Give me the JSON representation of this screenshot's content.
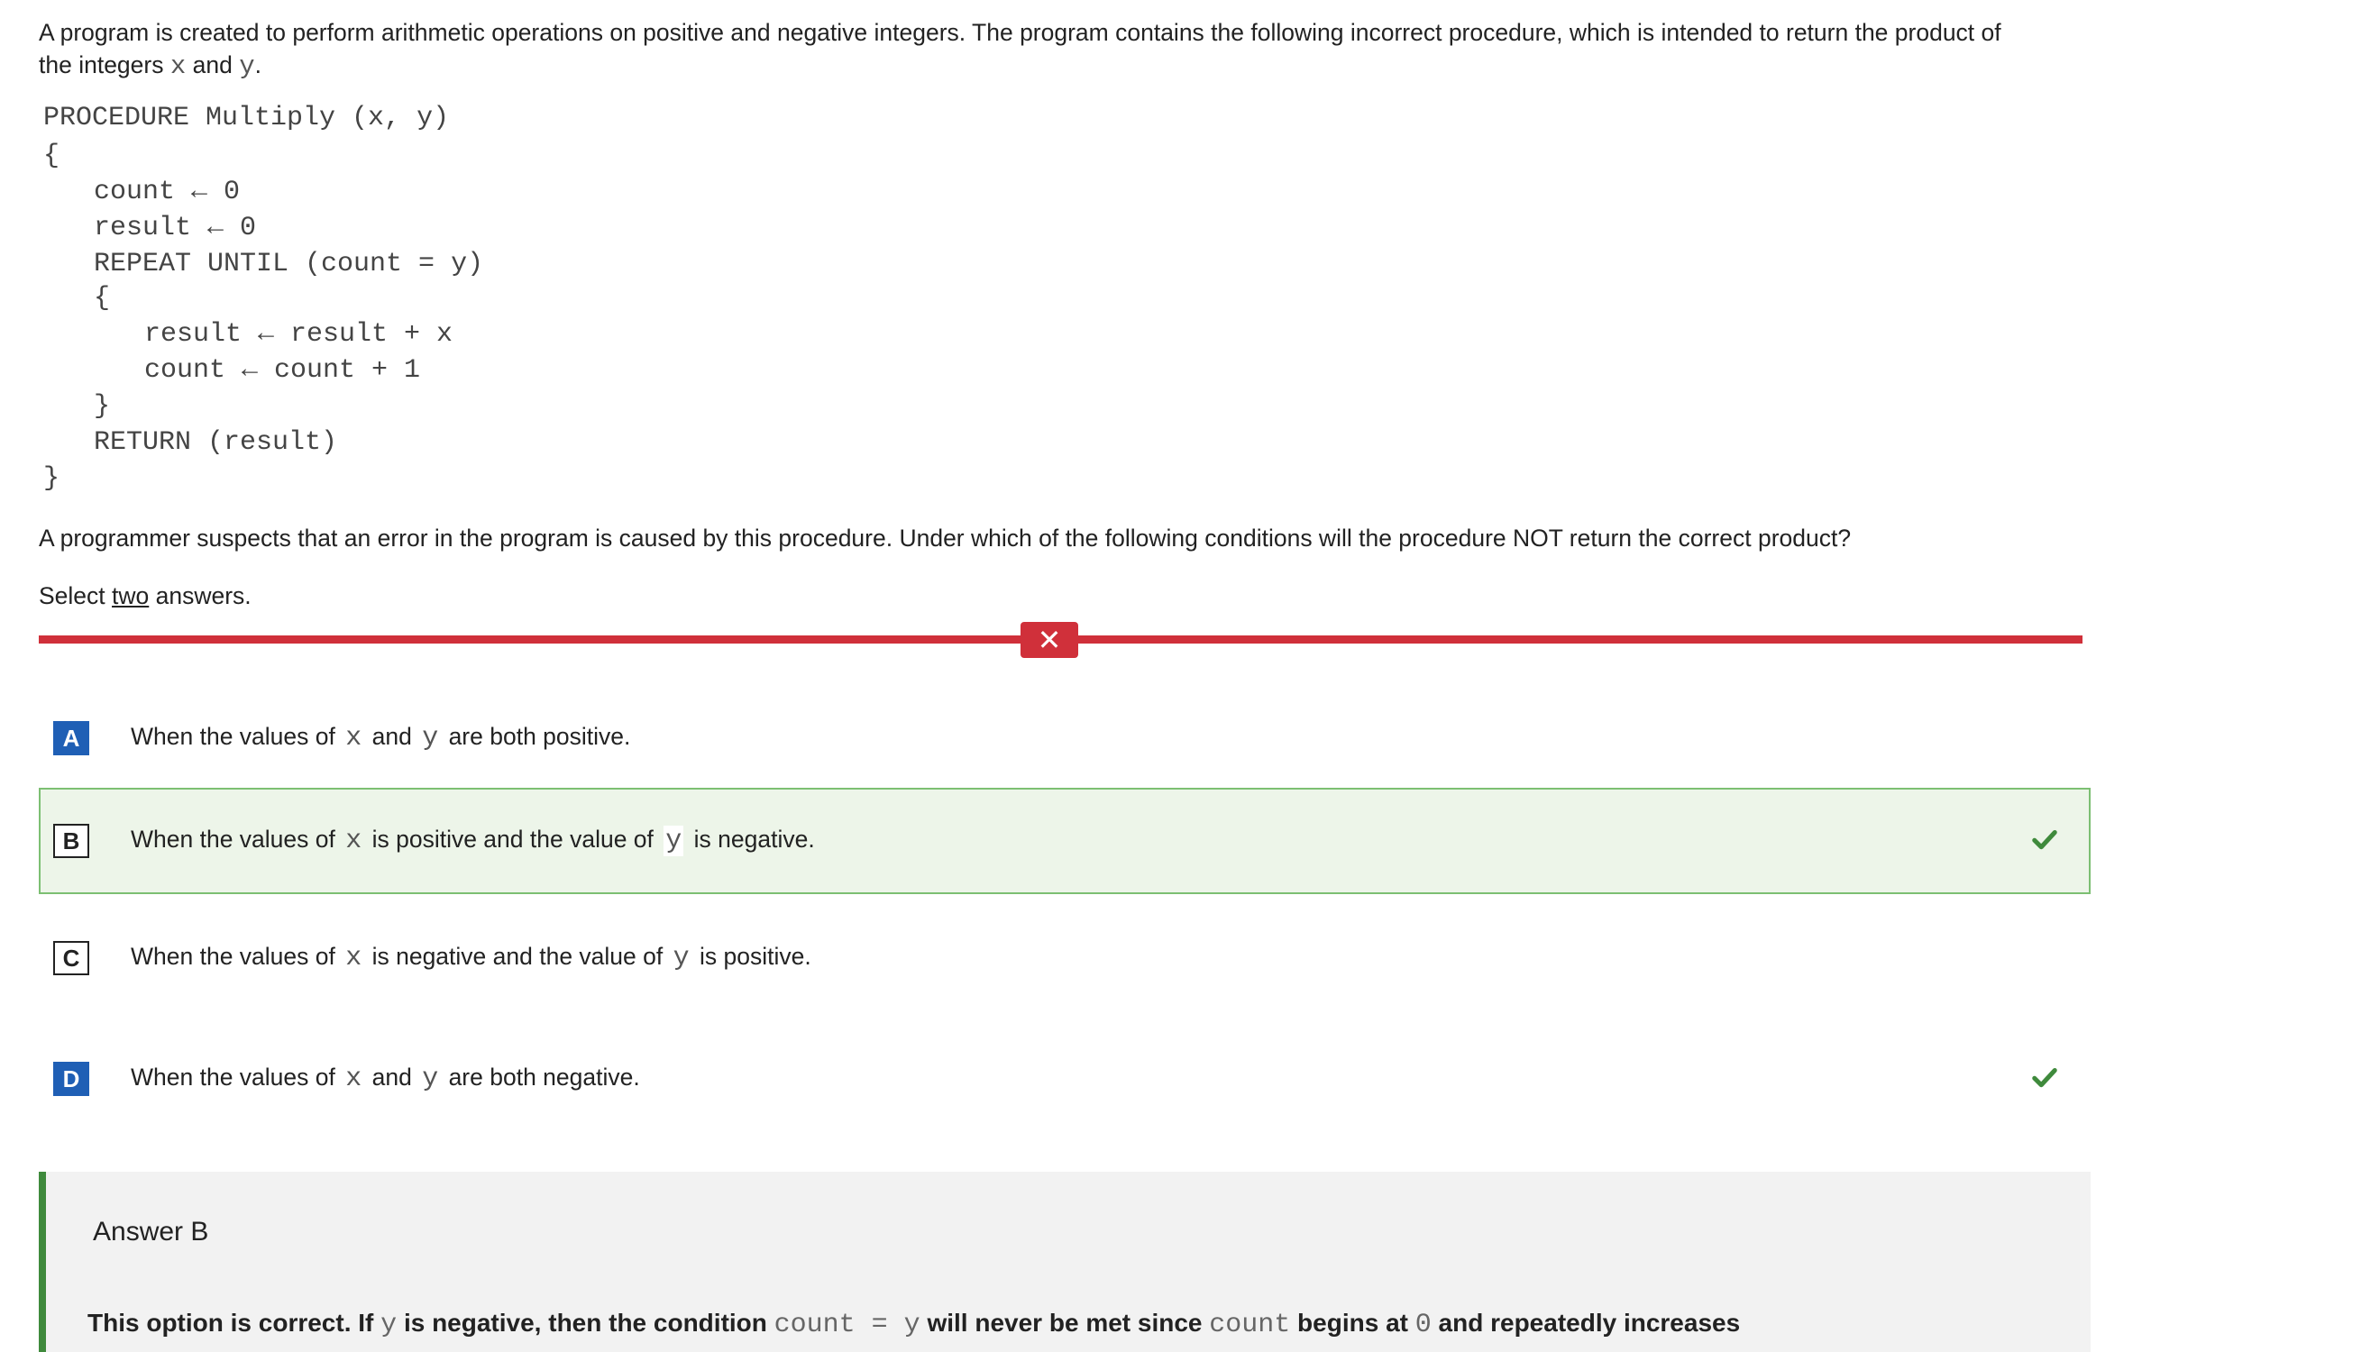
{
  "intro": {
    "text_1": "A program is created to perform arithmetic operations on positive and negative integers. The program contains the following incorrect procedure, which is intended to return the product of the integers ",
    "var_x": "x",
    "and": " and ",
    "var_y": "y",
    "period": "."
  },
  "code": {
    "lines": [
      "PROCEDURE Multiply (x, y)",
      "{",
      "count ← 0",
      "result ← 0",
      "REPEAT UNTIL (count = y)",
      "{",
      "result ← result + x",
      "count ← count + 1",
      "}",
      "RETURN (result)",
      "}"
    ]
  },
  "question": "A programmer suspects that an error in the program is caused by this procedure. Under which of the following conditions will the procedure NOT return the correct product?",
  "select": {
    "prefix": "Select ",
    "count": "two",
    "suffix": " answers."
  },
  "result_icon": "close-icon",
  "options": [
    {
      "letter": "A",
      "p1": "When the values of ",
      "v1": "x",
      "p2": " and ",
      "v2": "y",
      "p3": " are both positive."
    },
    {
      "letter": "B",
      "p1": "When the values of ",
      "v1": "x",
      "p2": " is positive and the value of ",
      "v2": "y",
      "p3": " is negative."
    },
    {
      "letter": "C",
      "p1": "When the values of ",
      "v1": "x",
      "p2": " is negative and the value of ",
      "v2": "y",
      "p3": " is positive."
    },
    {
      "letter": "D",
      "p1": "When the values of ",
      "v1": "x",
      "p2": " and ",
      "v2": "y",
      "p3": " are both negative."
    }
  ],
  "answer": {
    "title": "Answer B",
    "expl_1": "This option is correct. If ",
    "expl_var_y": "y",
    "expl_2": " is negative, then the condition ",
    "expl_code": "count = y",
    "expl_3": " will never be met since ",
    "expl_code2": "count",
    "expl_4": " begins at ",
    "expl_zero": "0",
    "expl_5": " and repeatedly increases"
  },
  "colors": {
    "wrong": "#d0303a",
    "correct": "#3f8a3c",
    "selected": "#1f5fb5"
  }
}
